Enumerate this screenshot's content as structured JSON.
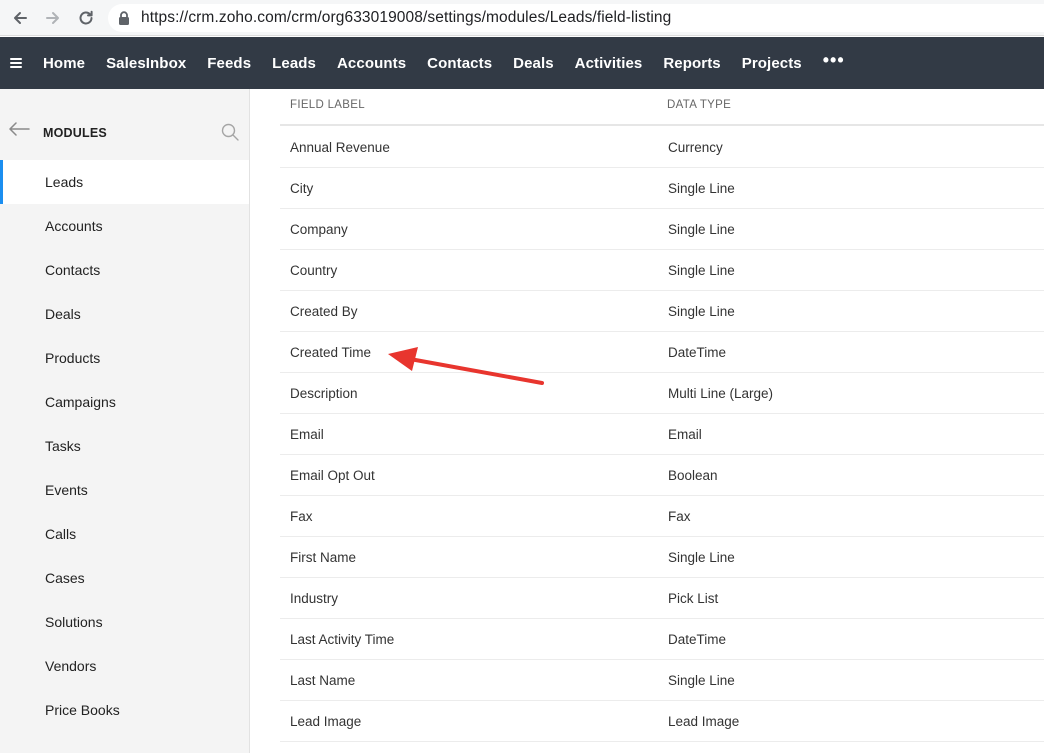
{
  "browser": {
    "url": "https://crm.zoho.com/crm/org633019008/settings/modules/Leads/field-listing"
  },
  "topnav": {
    "items": [
      "Home",
      "SalesInbox",
      "Feeds",
      "Leads",
      "Accounts",
      "Contacts",
      "Deals",
      "Activities",
      "Reports",
      "Projects"
    ],
    "more": "•••"
  },
  "sidebar": {
    "title": "MODULES",
    "items": [
      "Leads",
      "Accounts",
      "Contacts",
      "Deals",
      "Products",
      "Campaigns",
      "Tasks",
      "Events",
      "Calls",
      "Cases",
      "Solutions",
      "Vendors",
      "Price Books"
    ],
    "active": "Leads"
  },
  "table": {
    "headers": [
      "FIELD LABEL",
      "DATA TYPE"
    ],
    "rows": [
      {
        "label": "Annual Revenue",
        "type": "Currency"
      },
      {
        "label": "City",
        "type": "Single Line"
      },
      {
        "label": "Company",
        "type": "Single Line"
      },
      {
        "label": "Country",
        "type": "Single Line"
      },
      {
        "label": "Created By",
        "type": "Single Line"
      },
      {
        "label": "Created Time",
        "type": "DateTime"
      },
      {
        "label": "Description",
        "type": "Multi Line (Large)"
      },
      {
        "label": "Email",
        "type": "Email"
      },
      {
        "label": "Email Opt Out",
        "type": "Boolean"
      },
      {
        "label": "Fax",
        "type": "Fax"
      },
      {
        "label": "First Name",
        "type": "Single Line"
      },
      {
        "label": "Industry",
        "type": "Pick List"
      },
      {
        "label": "Last Activity Time",
        "type": "DateTime"
      },
      {
        "label": "Last Name",
        "type": "Single Line"
      },
      {
        "label": "Lead Image",
        "type": "Lead Image"
      }
    ]
  },
  "colors": {
    "topnav_bg": "#323a45",
    "active_indicator": "#1b8ef0",
    "annotation_arrow": "#e8352e"
  },
  "icons": {
    "back": "back-arrow-icon",
    "forward": "forward-arrow-icon",
    "reload": "reload-icon",
    "lock": "lock-icon",
    "menu": "hamburger-menu-icon",
    "sidebar_back": "left-arrow-icon",
    "search": "search-icon"
  }
}
